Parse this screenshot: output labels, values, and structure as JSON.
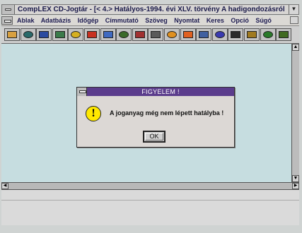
{
  "window": {
    "title": "CompLEX CD-Jogtár  - [< 4.> Hatályos-1994. évi XLV. törvény  A hadigondozásról"
  },
  "menu": {
    "items": [
      "Ablak",
      "Adatbázis",
      "Időgép",
      "Címmutató",
      "Szöveg",
      "Nyomtat",
      "Keres",
      "Opció",
      "Súgó"
    ]
  },
  "toolbar": {
    "buttons": [
      {
        "icon": "shelves-icon",
        "color": "#d8a040"
      },
      {
        "icon": "arrows-icon",
        "color": "#2a6a6a"
      },
      {
        "icon": "grid-icon",
        "color": "#2a4aa0"
      },
      {
        "icon": "documents-icon",
        "color": "#3a7a4a"
      },
      {
        "icon": "folder-icon",
        "color": "#d6b020"
      },
      {
        "icon": "clock-icon",
        "color": "#c83020"
      },
      {
        "icon": "cards-icon",
        "color": "#406ac0"
      },
      {
        "icon": "calendar-icon",
        "color": "#3a6a2a"
      },
      {
        "icon": "books-icon",
        "color": "#a03030"
      },
      {
        "icon": "printer-icon",
        "color": "#5a5a5a"
      },
      {
        "icon": "face-icon",
        "color": "#e09020"
      },
      {
        "icon": "face-sad-icon",
        "color": "#e06020"
      },
      {
        "icon": "magnifier-icon",
        "color": "#4060a0"
      },
      {
        "icon": "magnifier-doc-icon",
        "color": "#3a3ab0"
      },
      {
        "icon": "list-icon",
        "color": "#2a2a2a"
      },
      {
        "icon": "tag-icon",
        "color": "#a07a20"
      },
      {
        "icon": "book-icon",
        "color": "#2a7a2a"
      },
      {
        "icon": "exit-icon",
        "color": "#406a20"
      }
    ]
  },
  "dialog": {
    "title": "FIGYELEM !",
    "message": "A joganyag még nem lépett hatályba !",
    "ok_label": "OK",
    "icon": "exclamation-icon"
  },
  "colors": {
    "dialog_title_bg": "#5b3c8c",
    "doc_bg": "#c6dde0",
    "warning_yellow": "#ffe800"
  }
}
